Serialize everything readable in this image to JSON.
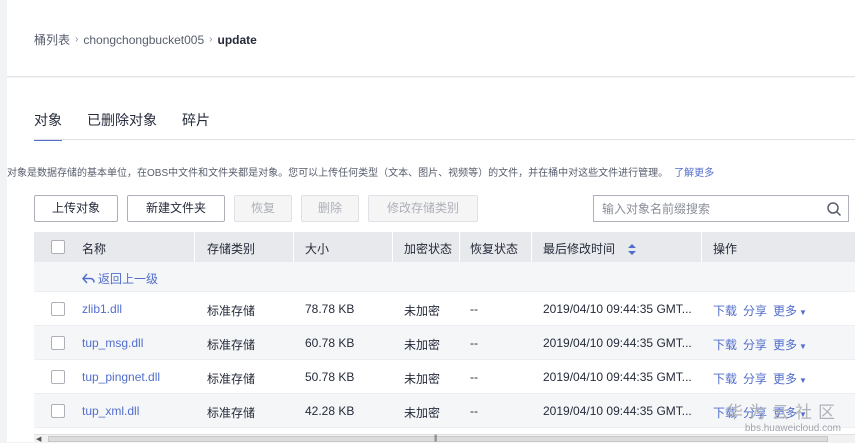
{
  "breadcrumb": {
    "root": "桶列表",
    "bucket": "chongchongbucket005",
    "current": "update"
  },
  "tabs": [
    {
      "label": "对象",
      "active": true
    },
    {
      "label": "已删除对象",
      "active": false
    },
    {
      "label": "碎片",
      "active": false
    }
  ],
  "info": {
    "text": "对象是数据存储的基本单位，在OBS中文件和文件夹都是对象。您可以上传任何类型（文本、图片、视频等）的文件，并在桶中对这些文件进行管理。",
    "link": "了解更多"
  },
  "toolbar": {
    "upload": "上传对象",
    "new_folder": "新建文件夹",
    "restore": "恢复",
    "delete": "删除",
    "modify_storage": "修改存储类别"
  },
  "search": {
    "placeholder": "输入对象名前缀搜索",
    "icon": "search-icon"
  },
  "table": {
    "headers": {
      "name": "名称",
      "storage_type": "存储类别",
      "size": "大小",
      "encryption": "加密状态",
      "restore": "恢复状态",
      "modified": "最后修改时间",
      "ops": "操作"
    },
    "back": "返回上一级",
    "rows": [
      {
        "name": "zlib1.dll",
        "storage_type": "标准存储",
        "size": "78.78 KB",
        "encryption": "未加密",
        "restore": "--",
        "modified": "2019/04/10 09:44:35 GMT...",
        "download": "下载",
        "share": "分享",
        "more": "更多"
      },
      {
        "name": "tup_msg.dll",
        "storage_type": "标准存储",
        "size": "60.78 KB",
        "encryption": "未加密",
        "restore": "--",
        "modified": "2019/04/10 09:44:35 GMT...",
        "download": "下载",
        "share": "分享",
        "more": "更多"
      },
      {
        "name": "tup_pingnet.dll",
        "storage_type": "标准存储",
        "size": "50.78 KB",
        "encryption": "未加密",
        "restore": "--",
        "modified": "2019/04/10 09:44:35 GMT...",
        "download": "下载",
        "share": "分享",
        "more": "更多"
      },
      {
        "name": "tup_xml.dll",
        "storage_type": "标准存储",
        "size": "42.28 KB",
        "encryption": "未加密",
        "restore": "--",
        "modified": "2019/04/10 09:44:35 GMT...",
        "download": "下载",
        "share": "分享",
        "more": "更多"
      }
    ]
  },
  "watermark": {
    "title": "华为云社区",
    "url": "bbs.huaweicloud.com"
  },
  "colors": {
    "accent": "#526ecc",
    "header_bg": "#e8e9ec"
  }
}
